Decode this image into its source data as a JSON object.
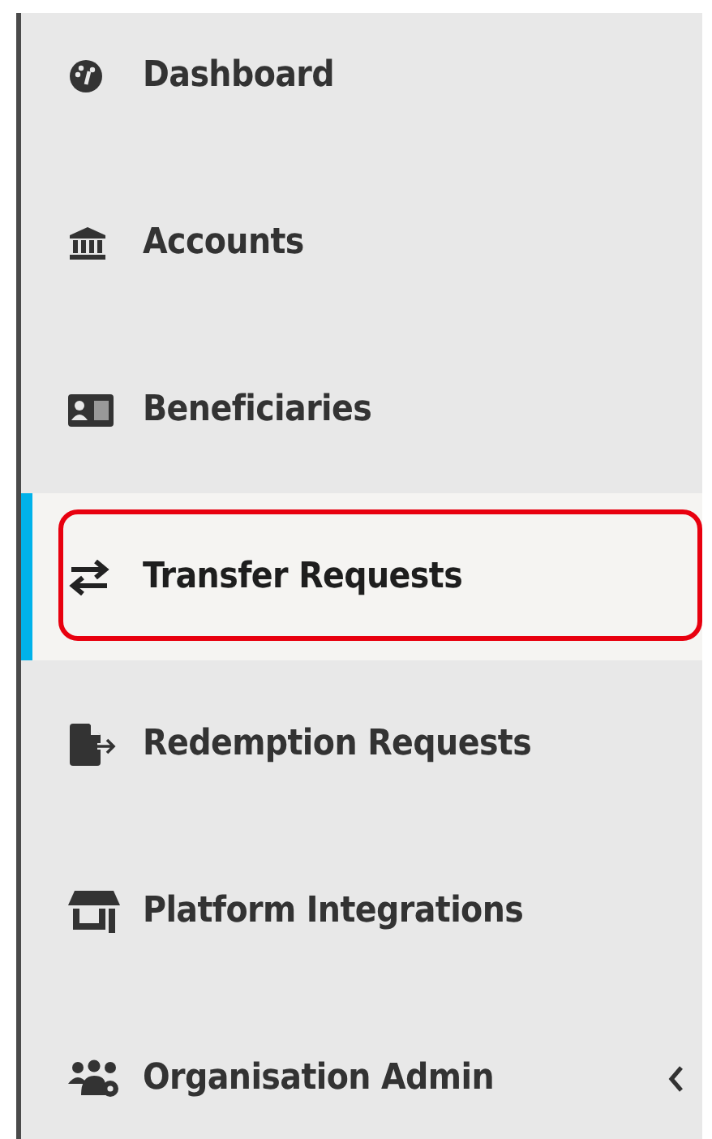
{
  "sidebar": {
    "items": [
      {
        "label": "Dashboard",
        "selected": false,
        "highlighted": false
      },
      {
        "label": "Accounts",
        "selected": false,
        "highlighted": false
      },
      {
        "label": "Beneficiaries",
        "selected": false,
        "highlighted": false
      },
      {
        "label": "Transfer Requests",
        "selected": true,
        "highlighted": true
      },
      {
        "label": "Redemption Requests",
        "selected": false,
        "highlighted": false
      },
      {
        "label": "Platform Integrations",
        "selected": false,
        "highlighted": false
      },
      {
        "label": "Organisation Admin",
        "selected": false,
        "highlighted": false,
        "expanded": false
      }
    ]
  }
}
